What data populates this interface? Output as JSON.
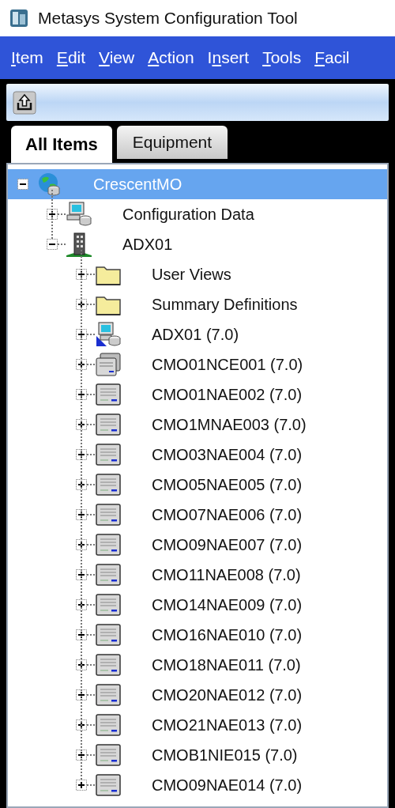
{
  "window": {
    "title": "Metasys System Configuration Tool"
  },
  "menu": [
    {
      "key": "I",
      "post": "tem"
    },
    {
      "key": "E",
      "post": "dit"
    },
    {
      "key": "V",
      "post": "iew"
    },
    {
      "key": "A",
      "post": "ction"
    },
    {
      "pre": "I",
      "key": "n",
      "post": "sert"
    },
    {
      "key": "T",
      "post": "ools"
    },
    {
      "key": "F",
      "post": "acil"
    }
  ],
  "tabs": [
    {
      "label": "All Items",
      "selected": true
    },
    {
      "label": "Equipment",
      "selected": false
    }
  ],
  "tree": [
    {
      "label": "CrescentMO",
      "kind": "site",
      "selected": true,
      "expanded": true,
      "children": [
        {
          "label": "Configuration Data",
          "kind": "config",
          "selected": false,
          "expanded": false
        },
        {
          "label": "ADX01",
          "kind": "building",
          "selected": false,
          "expanded": true,
          "children": [
            {
              "label": "User Views",
              "kind": "folder",
              "selected": false,
              "expanded": false
            },
            {
              "label": "Summary Definitions",
              "kind": "folder",
              "selected": false,
              "expanded": false
            },
            {
              "label": "ADX01 (7.0)",
              "kind": "server",
              "selected": false,
              "expanded": false
            },
            {
              "label": "CMO01NCE001 (7.0)",
              "kind": "nce",
              "selected": false,
              "expanded": false
            },
            {
              "label": "CMO01NAE002 (7.0)",
              "kind": "nae",
              "selected": false,
              "expanded": false
            },
            {
              "label": "CMO1MNAE003 (7.0)",
              "kind": "nae",
              "selected": false,
              "expanded": false
            },
            {
              "label": "CMO03NAE004 (7.0)",
              "kind": "nae",
              "selected": false,
              "expanded": false
            },
            {
              "label": "CMO05NAE005 (7.0)",
              "kind": "nae",
              "selected": false,
              "expanded": false
            },
            {
              "label": "CMO07NAE006 (7.0)",
              "kind": "nae",
              "selected": false,
              "expanded": false
            },
            {
              "label": "CMO09NAE007 (7.0)",
              "kind": "nae",
              "selected": false,
              "expanded": false
            },
            {
              "label": "CMO11NAE008 (7.0)",
              "kind": "nae",
              "selected": false,
              "expanded": false
            },
            {
              "label": "CMO14NAE009 (7.0)",
              "kind": "nae",
              "selected": false,
              "expanded": false
            },
            {
              "label": "CMO16NAE010 (7.0)",
              "kind": "nae",
              "selected": false,
              "expanded": false
            },
            {
              "label": "CMO18NAE011 (7.0)",
              "kind": "nae",
              "selected": false,
              "expanded": false
            },
            {
              "label": "CMO20NAE012 (7.0)",
              "kind": "nae",
              "selected": false,
              "expanded": false
            },
            {
              "label": "CMO21NAE013 (7.0)",
              "kind": "nae",
              "selected": false,
              "expanded": false
            },
            {
              "label": "CMOB1NIE015 (7.0)",
              "kind": "nae",
              "selected": false,
              "expanded": false
            },
            {
              "label": "CMO09NAE014 (7.0)",
              "kind": "nae",
              "selected": false,
              "expanded": false
            }
          ]
        }
      ]
    }
  ]
}
